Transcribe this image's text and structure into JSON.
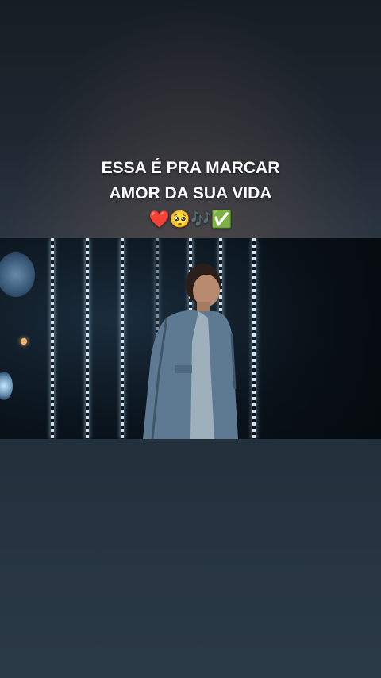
{
  "caption": {
    "line1": "ESSA É PRA MARCAR",
    "line2": "AMOR DA SUA VIDA",
    "emojis": "❤️🥺🎶✅"
  },
  "video": {
    "scene_icon": "performer-on-stage"
  },
  "colors": {
    "background_top": "#171d24",
    "background_bottom": "#2b3a47",
    "caption_text": "#ffffff",
    "video_bg": "#0b1620"
  }
}
